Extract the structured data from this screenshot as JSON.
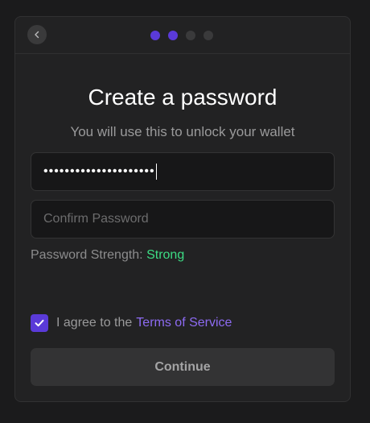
{
  "header": {
    "back_icon": "chevron-left-icon",
    "steps": [
      {
        "active": true
      },
      {
        "active": true
      },
      {
        "active": false
      },
      {
        "active": false
      }
    ],
    "active_color": "#5a3ad8"
  },
  "main": {
    "title": "Create a password",
    "subtitle": "You will use this to unlock your wallet"
  },
  "form": {
    "password_value": "•••••••••••••••••••••",
    "confirm_placeholder": "Confirm Password",
    "strength_label": "Password Strength:",
    "strength_value": "Strong",
    "strength_color": "#3ddc84"
  },
  "agreement": {
    "checked": true,
    "text": "I agree to the",
    "link": "Terms of Service",
    "link_color": "#8d6bf2"
  },
  "actions": {
    "continue_label": "Continue"
  }
}
